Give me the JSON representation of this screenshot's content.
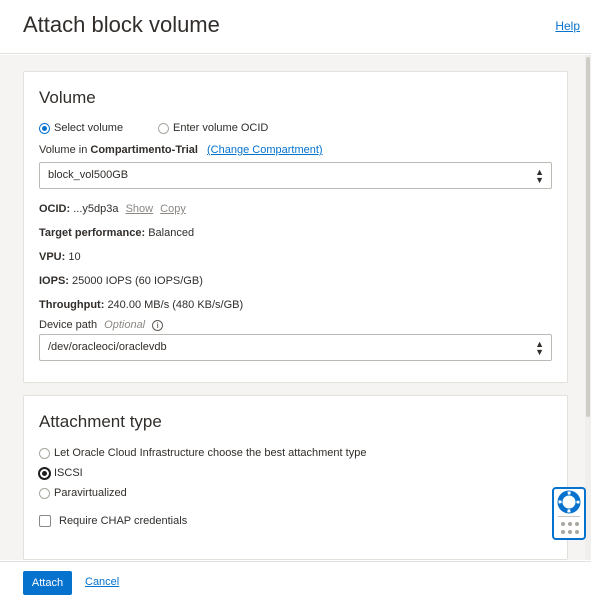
{
  "header": {
    "title": "Attach block volume",
    "help": "Help"
  },
  "volume": {
    "heading": "Volume",
    "radio_select": "Select volume",
    "radio_enter": "Enter volume OCID",
    "volume_in_prefix": "Volume in",
    "compartment": "Compartimento-Trial",
    "change_compartment": "(Change Compartment)",
    "selected_volume": "block_vol500GB",
    "ocid_label": "OCID:",
    "ocid_value": "...y5dp3a",
    "show": "Show",
    "copy": "Copy",
    "perf_label": "Target performance:",
    "perf_value": "Balanced",
    "vpu_label": "VPU:",
    "vpu_value": "10",
    "iops_label": "IOPS:",
    "iops_value": "25000 IOPS (60 IOPS/GB)",
    "throughput_label": "Throughput:",
    "throughput_value": "240.00 MB/s (480 KB/s/GB)",
    "device_path_label": "Device path",
    "optional": "Optional",
    "info_glyph": "i",
    "device_path_value": "/dev/oracleoci/oraclevdb"
  },
  "attachment": {
    "heading": "Attachment type",
    "options": [
      "Let Oracle Cloud Infrastructure choose the best attachment type",
      "ISCSI",
      "Paravirtualized"
    ],
    "selected": "ISCSI",
    "chap_label": "Require CHAP credentials"
  },
  "footer": {
    "attach": "Attach",
    "cancel": "Cancel"
  },
  "colors": {
    "accent": "#0572ce",
    "background": "#f5f4f2",
    "text": "#312d2a"
  },
  "icons": {
    "help_widget": "lifebuoy-icon",
    "select_chevron": "chevron-updown-icon",
    "info": "info-icon"
  }
}
